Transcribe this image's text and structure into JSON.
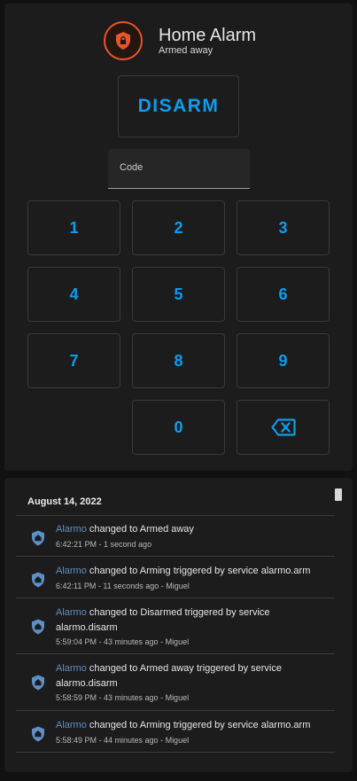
{
  "alarm": {
    "title": "Home Alarm",
    "state": "Armed away",
    "action_label": "DISARM",
    "code_label": "Code",
    "keys": [
      "1",
      "2",
      "3",
      "4",
      "5",
      "6",
      "7",
      "8",
      "9",
      "0"
    ],
    "accent_color": "#0c9ded",
    "badge_color": "#e8552b"
  },
  "logbook": {
    "date": "August 14, 2022",
    "entries": [
      {
        "entity": "Alarmo",
        "line1": "changed to Armed away",
        "line2": "",
        "meta": "6:42:21 PM - 1 second ago",
        "icon": "shield-home-icon"
      },
      {
        "entity": "Alarmo",
        "line1": "changed to Arming triggered by service alarmo.arm",
        "line2": "",
        "meta": "6:42:11 PM - 11 seconds ago - Miguel",
        "icon": "shield-home-icon"
      },
      {
        "entity": "Alarmo",
        "line1": "changed to Disarmed triggered by service",
        "line2": "alarmo.disarm",
        "meta": "5:59:04 PM - 43 minutes ago - Miguel",
        "icon": "shield-home-icon"
      },
      {
        "entity": "Alarmo",
        "line1": "changed to Armed away triggered by service",
        "line2": "alarmo.disarm",
        "meta": "5:58:59 PM - 43 minutes ago - Miguel",
        "icon": "shield-home-icon"
      },
      {
        "entity": "Alarmo",
        "line1": "changed to Arming triggered by service alarmo.arm",
        "line2": "",
        "meta": "5:58:49 PM - 44 minutes ago - Miguel",
        "icon": "shield-home-icon"
      }
    ],
    "entity_color": "#5e8fc7"
  }
}
